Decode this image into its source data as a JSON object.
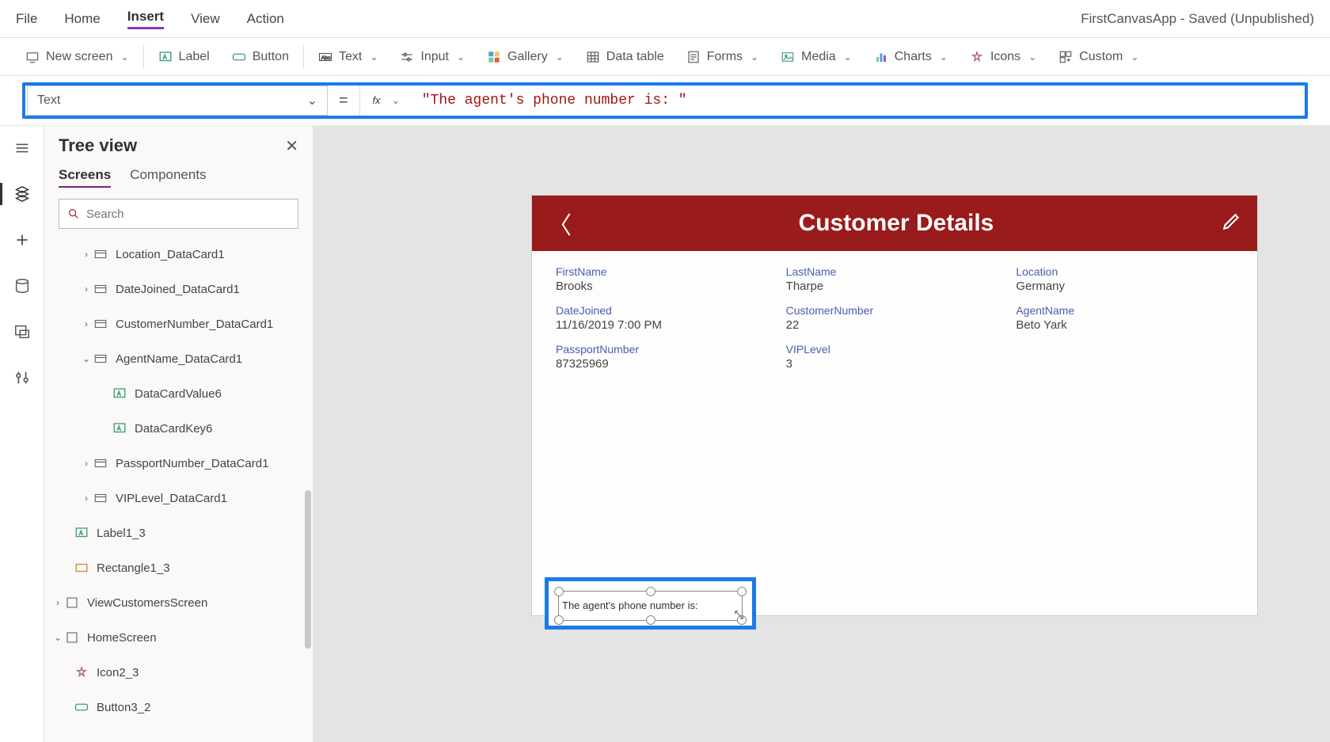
{
  "menu": {
    "file": "File",
    "home": "Home",
    "insert": "Insert",
    "view": "View",
    "action": "Action",
    "app_title": "FirstCanvasApp - Saved (Unpublished)"
  },
  "ribbon": {
    "new_screen": "New screen",
    "label": "Label",
    "button": "Button",
    "text": "Text",
    "input": "Input",
    "gallery": "Gallery",
    "data_table": "Data table",
    "forms": "Forms",
    "media": "Media",
    "charts": "Charts",
    "icons": "Icons",
    "custom": "Custom"
  },
  "formula": {
    "property": "Text",
    "value": "\"The agent's phone number is: \""
  },
  "tree": {
    "title": "Tree view",
    "tab_screens": "Screens",
    "tab_components": "Components",
    "search_placeholder": "Search",
    "nodes": {
      "loc": "Location_DataCard1",
      "date": "DateJoined_DataCard1",
      "cust": "CustomerNumber_DataCard1",
      "agent": "AgentName_DataCard1",
      "dcv6": "DataCardValue6",
      "dck6": "DataCardKey6",
      "pass": "PassportNumber_DataCard1",
      "vip": "VIPLevel_DataCard1",
      "label13": "Label1_3",
      "rect13": "Rectangle1_3",
      "viewcust": "ViewCustomersScreen",
      "home": "HomeScreen",
      "icon23": "Icon2_3",
      "btn32": "Button3_2"
    }
  },
  "canvas": {
    "header_title": "Customer Details",
    "fields": {
      "firstname_l": "FirstName",
      "firstname_v": "Brooks",
      "lastname_l": "LastName",
      "lastname_v": "Tharpe",
      "location_l": "Location",
      "location_v": "Germany",
      "datejoined_l": "DateJoined",
      "datejoined_v": "11/16/2019 7:00 PM",
      "custnum_l": "CustomerNumber",
      "custnum_v": "22",
      "agent_l": "AgentName",
      "agent_v": "Beto Yark",
      "passport_l": "PassportNumber",
      "passport_v": "87325969",
      "vip_l": "VIPLevel",
      "vip_v": "3"
    },
    "selected_text": "The agent's phone number is:"
  }
}
